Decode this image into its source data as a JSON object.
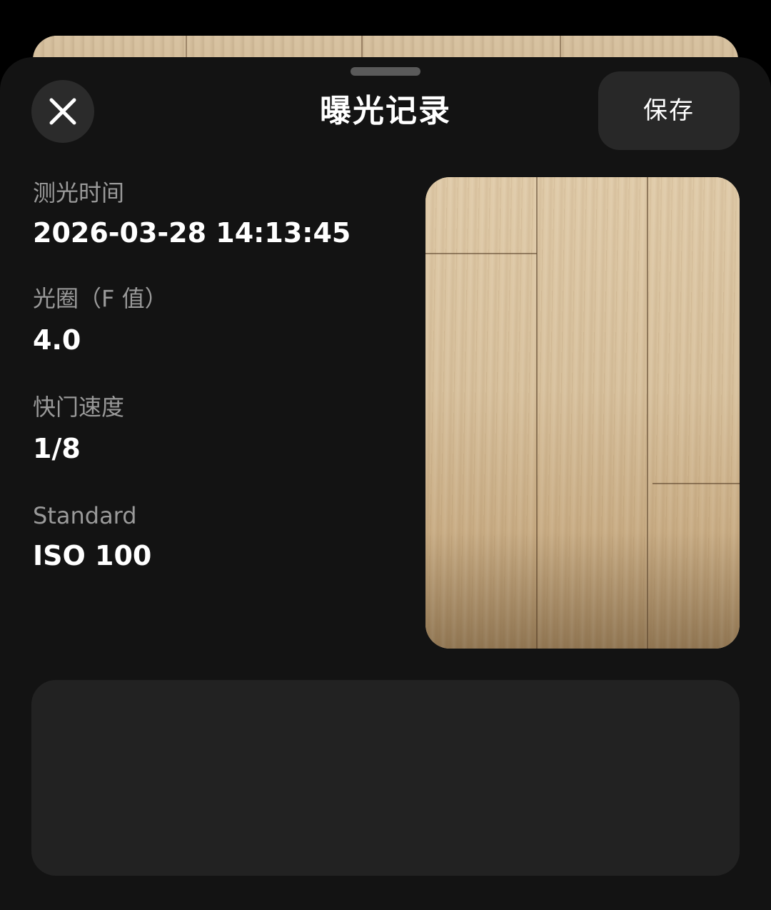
{
  "sheet": {
    "title": "曝光记录",
    "save_label": "保存",
    "close_icon": "close-icon"
  },
  "fields": {
    "metering_time": {
      "label": "测光时间",
      "value": "2026-03-28 14:13:45"
    },
    "aperture": {
      "label": "光圈（F 值）",
      "value": "4.0"
    },
    "shutter_speed": {
      "label": "快门速度",
      "value": "1/8"
    },
    "iso": {
      "label": "Standard",
      "value": "ISO 100"
    }
  },
  "colors": {
    "sheet_background": "#131313",
    "button_background": "#282828",
    "label_text": "#9a9a9a",
    "value_text": "#ffffff"
  }
}
